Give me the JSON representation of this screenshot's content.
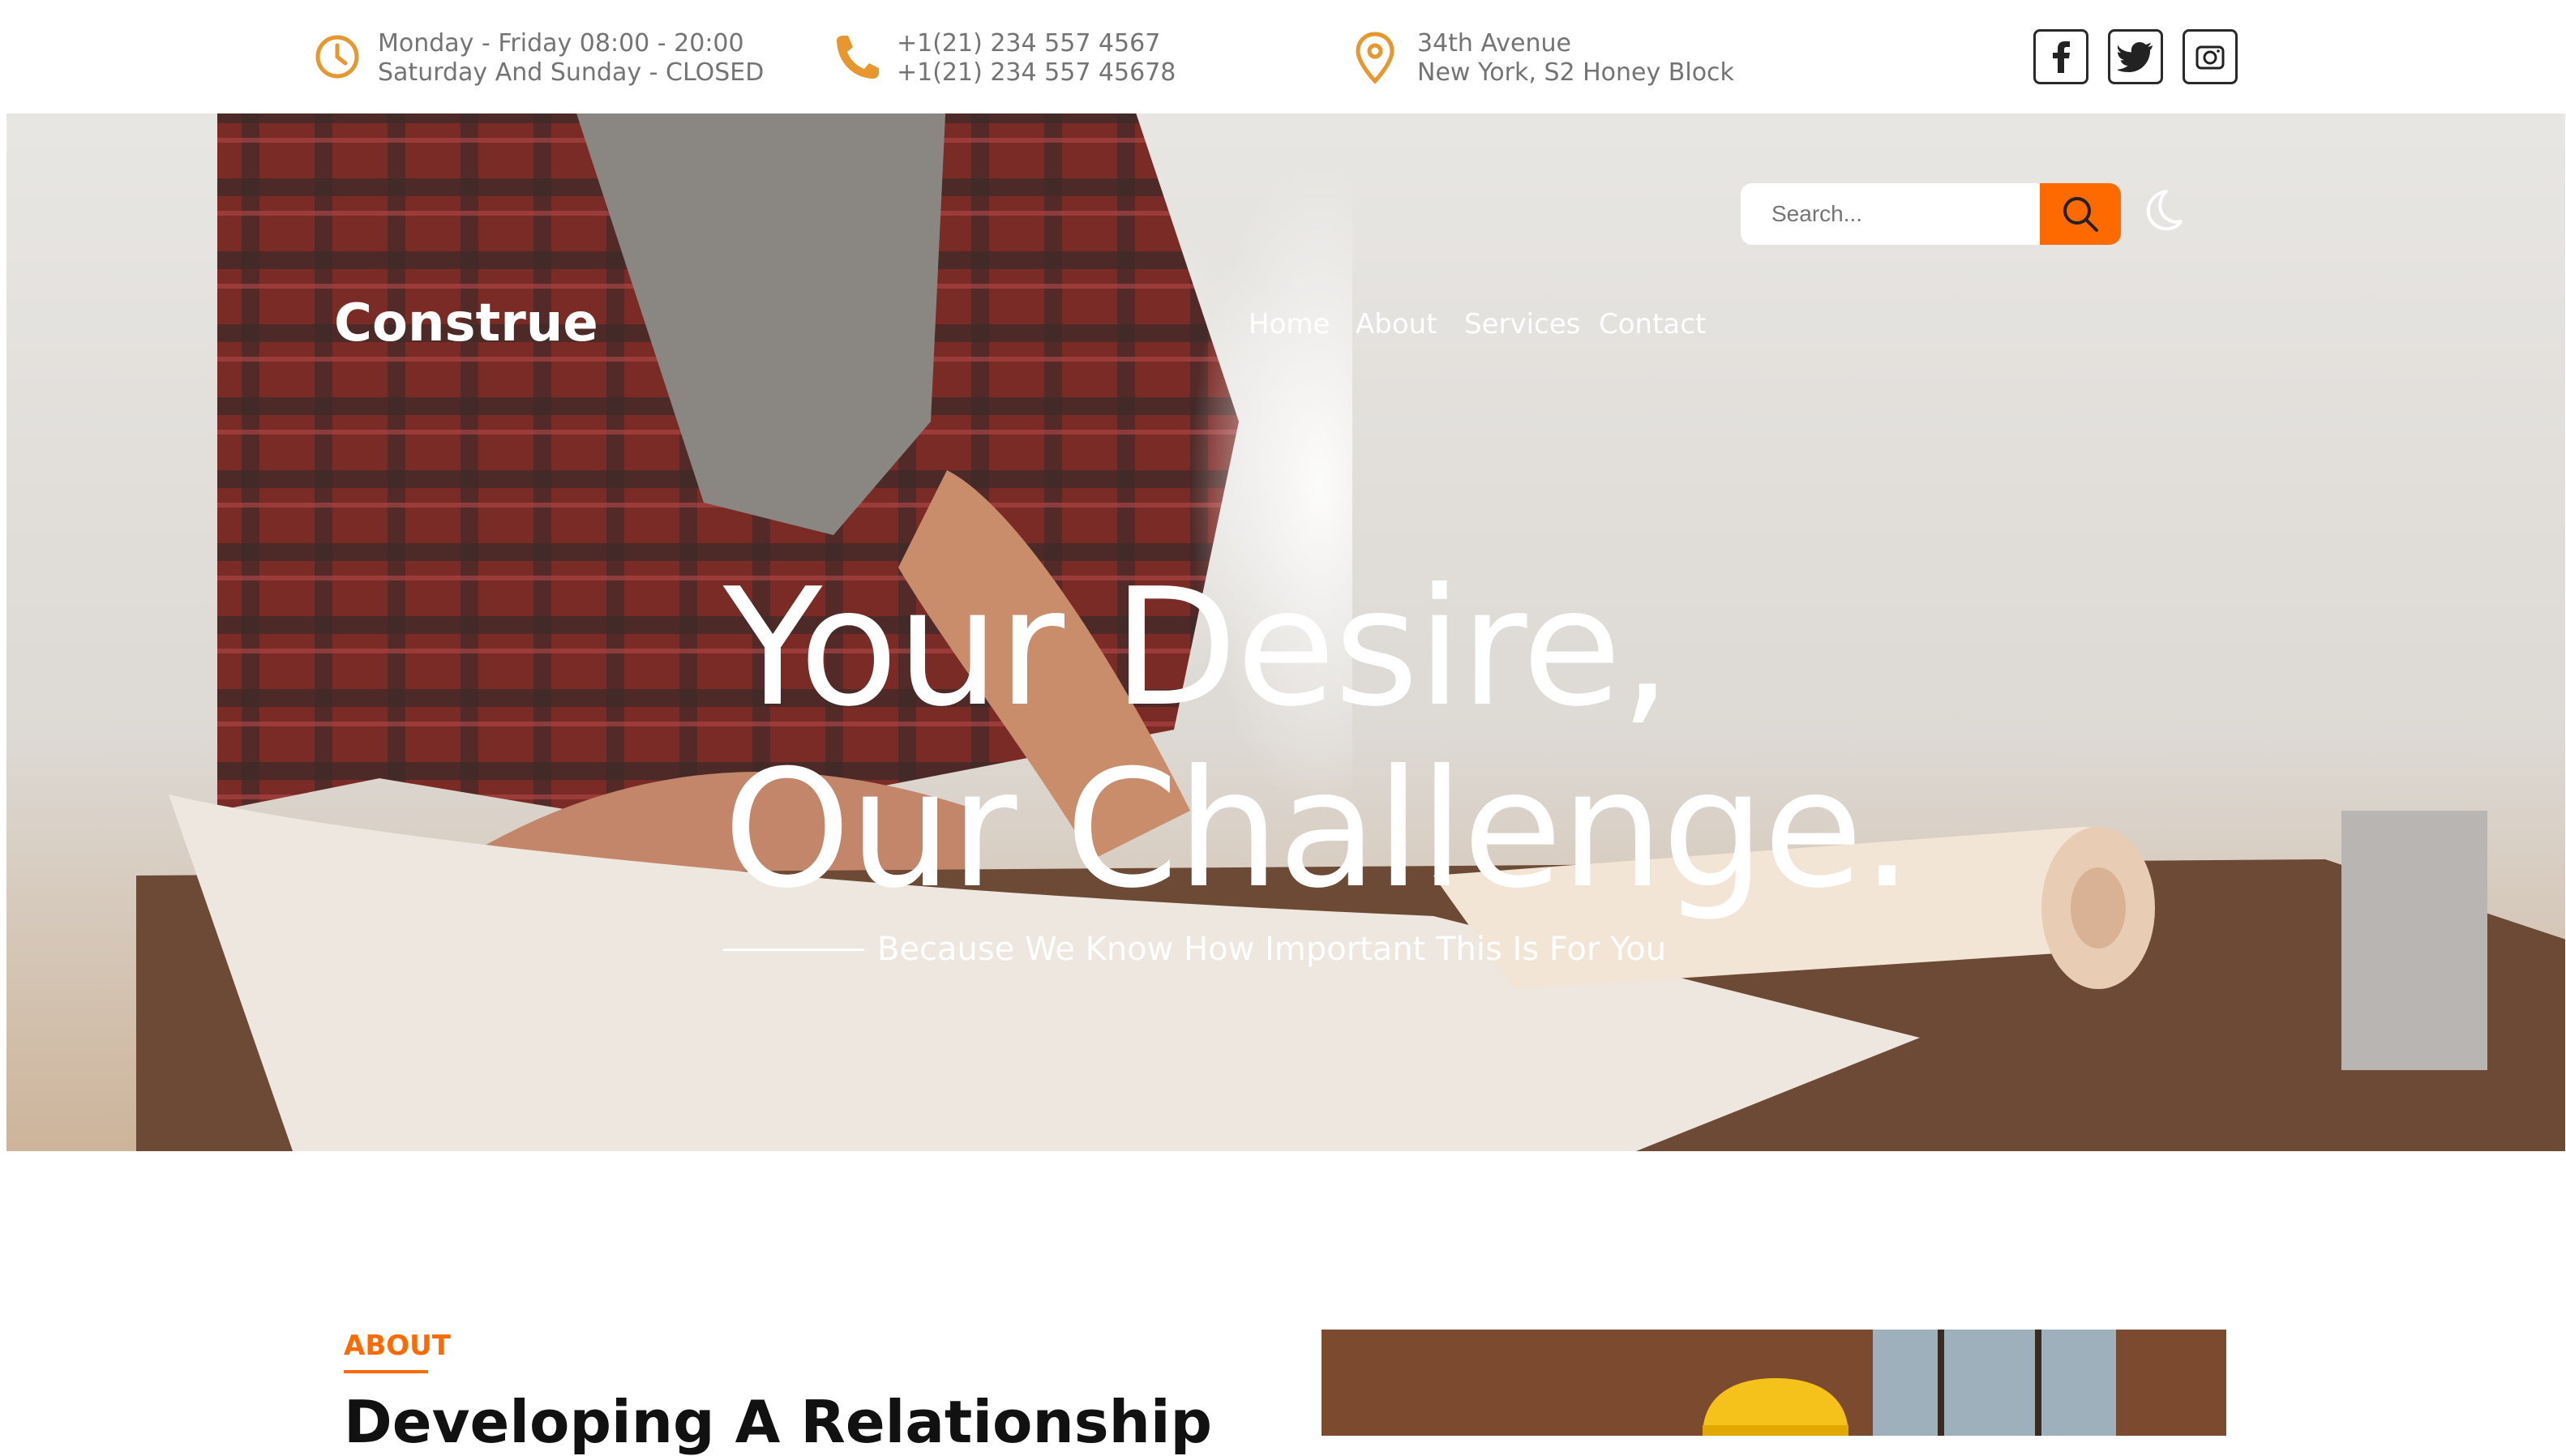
{
  "topbar": {
    "hours": {
      "icon": "clock-icon",
      "line1": "Monday - Friday 08:00 - 20:00",
      "line2": "Saturday And Sunday - CLOSED"
    },
    "phone": {
      "icon": "phone-icon",
      "line1": "+1(21) 234 557 4567",
      "line2": "+1(21) 234 557 45678"
    },
    "address": {
      "icon": "location-pin-icon",
      "line1": "34th Avenue",
      "line2": "New York, S2 Honey Block"
    },
    "social": [
      "facebook-icon",
      "twitter-icon",
      "instagram-icon"
    ]
  },
  "header": {
    "logo": "Construe",
    "nav": [
      "Home",
      "About",
      "Services",
      "Contact"
    ],
    "search_placeholder": "Search...",
    "theme_toggle_icon": "moon-icon"
  },
  "hero": {
    "headline_line1": "Your Desire,",
    "headline_line2": "Our Challenge.",
    "subtitle": "Because We Know How Important This Is For You"
  },
  "about": {
    "label": "ABOUT",
    "title": "Developing A Relationship"
  },
  "colors": {
    "accent": "#ff6a00",
    "icon_accent": "#e8962e",
    "text_muted": "#747474"
  }
}
